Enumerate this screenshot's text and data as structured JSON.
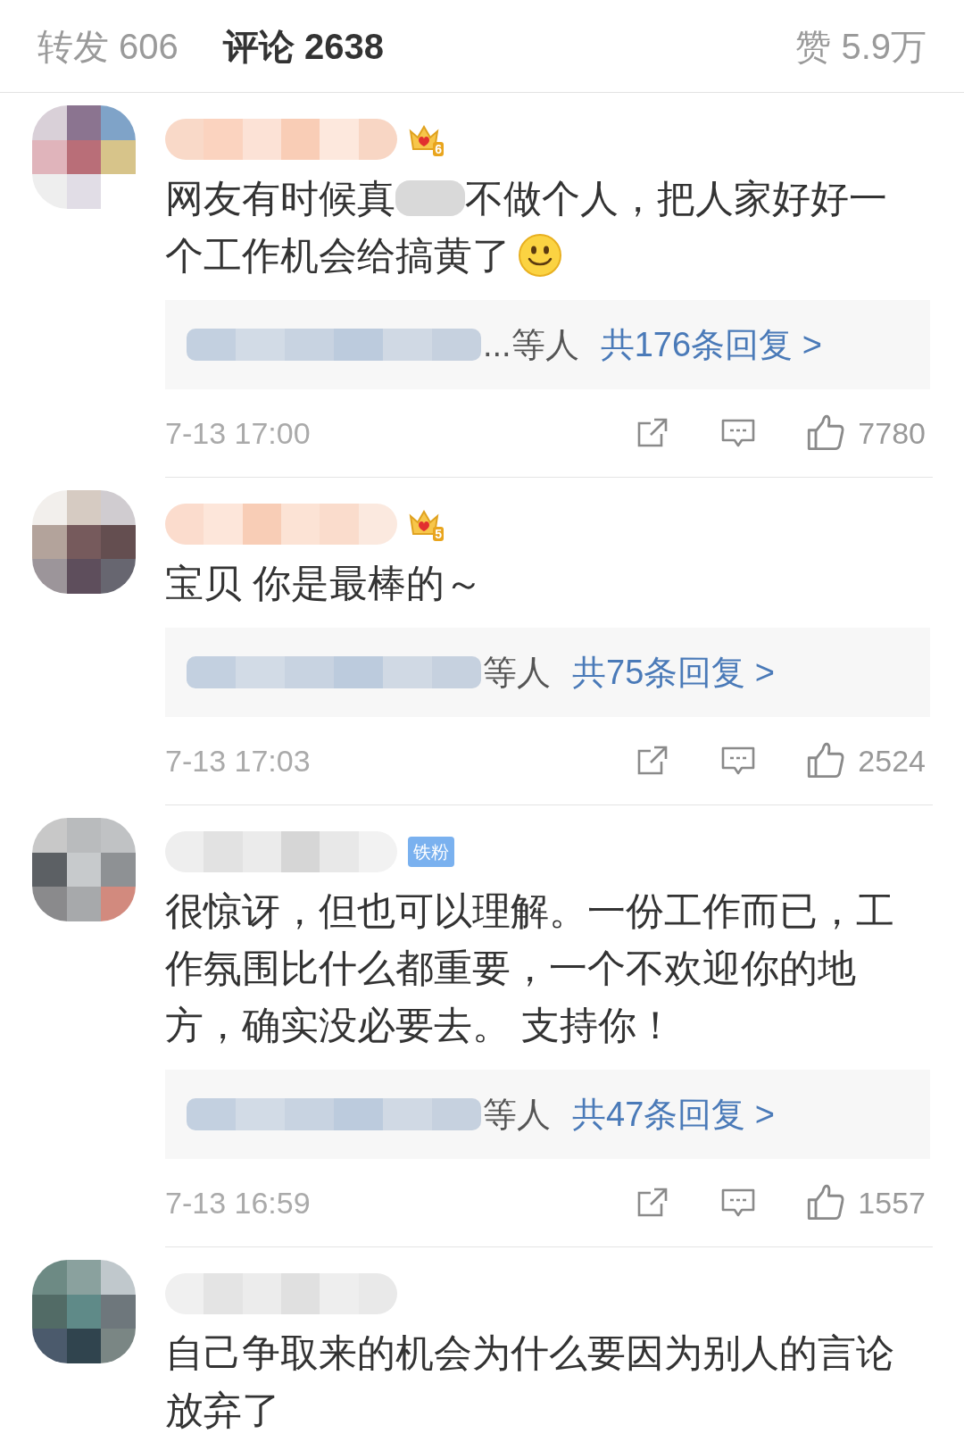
{
  "tabs": [
    {
      "label": "转发 606",
      "selected": false
    },
    {
      "label": "评论 2638",
      "selected": true
    }
  ],
  "likes_tab": "赞 5.9万",
  "comments": [
    {
      "badge": {
        "kind": "crown",
        "label": "6"
      },
      "lines": [
        [
          "网友有时候真",
          "不做个人，把人家好好一"
        ],
        [
          "个工作机会给搞黄了"
        ]
      ],
      "emoji": true,
      "replies": {
        "suffix": "...等人",
        "link": "共176条回复 >"
      },
      "time": "7-13 17:00",
      "likes": "7780"
    },
    {
      "badge": {
        "kind": "crown",
        "label": "5"
      },
      "lines": [
        [
          "宝贝 你是最棒的～"
        ]
      ],
      "emoji": false,
      "replies": {
        "suffix": "等人",
        "link": "共75条回复 >"
      },
      "time": "7-13 17:03",
      "likes": "2524"
    },
    {
      "badge": {
        "kind": "fan",
        "label": "铁粉"
      },
      "lines": [
        [
          "很惊讶，但也可以理解。一份工作而已，工作氛围比什么都重要，一个不欢迎你的地方，确实没必要去。 支持你！"
        ]
      ],
      "emoji": false,
      "replies": {
        "suffix": "等人",
        "link": "共47条回复 >"
      },
      "time": "7-13 16:59",
      "likes": "1557"
    },
    {
      "lines": [
        [
          "自己争取来的机会为什么要因为别人的言论放弃了"
        ]
      ]
    }
  ]
}
